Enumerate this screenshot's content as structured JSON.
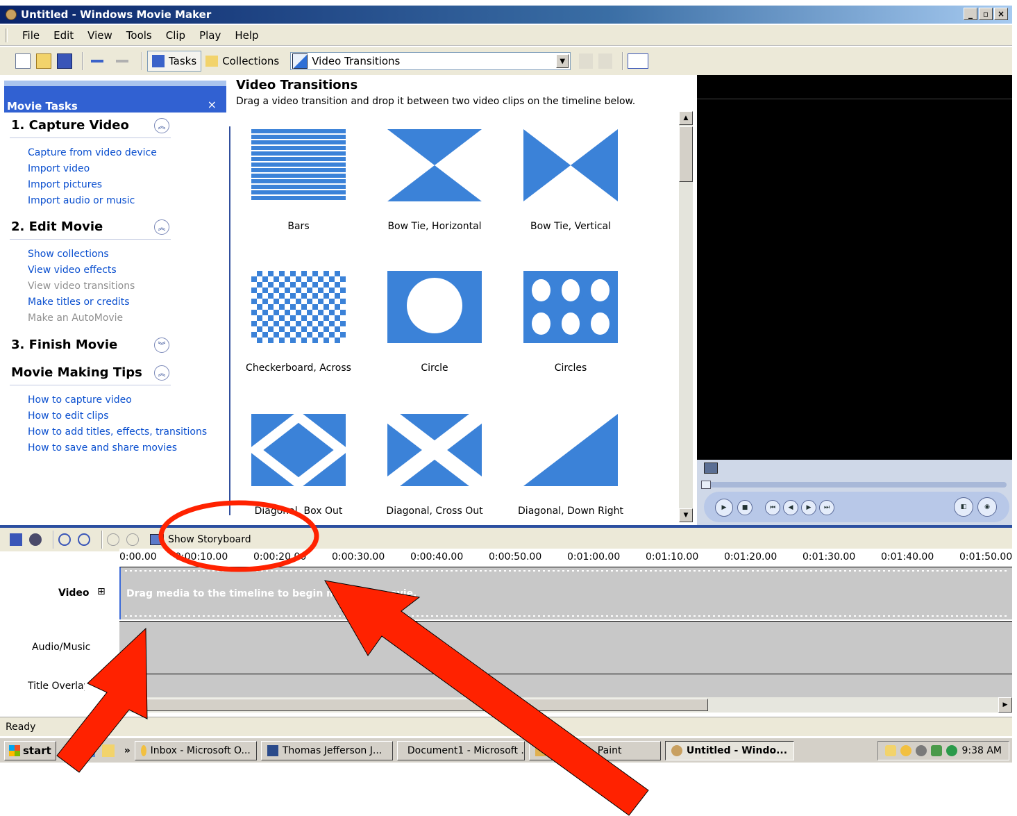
{
  "window": {
    "title": "Untitled - Windows Movie Maker",
    "min": "_",
    "max": "▫",
    "close": "×"
  },
  "menu": [
    "File",
    "Edit",
    "View",
    "Tools",
    "Clip",
    "Play",
    "Help"
  ],
  "toolbar": {
    "tasks_label": "Tasks",
    "collections_label": "Collections",
    "collection_select": "Video Transitions"
  },
  "task_pane": {
    "header": "Movie Tasks",
    "close": "×",
    "sections": [
      {
        "title": "1. Capture Video",
        "chevron": "up",
        "links": [
          {
            "text": "Capture from video device",
            "enabled": true
          },
          {
            "text": "Import video",
            "enabled": true
          },
          {
            "text": "Import pictures",
            "enabled": true
          },
          {
            "text": "Import audio or music",
            "enabled": true
          }
        ]
      },
      {
        "title": "2. Edit Movie",
        "chevron": "up",
        "links": [
          {
            "text": "Show collections",
            "enabled": true
          },
          {
            "text": "View video effects",
            "enabled": true
          },
          {
            "text": "View video transitions",
            "enabled": false
          },
          {
            "text": "Make titles or credits",
            "enabled": true
          },
          {
            "text": "Make an AutoMovie",
            "enabled": false
          }
        ]
      },
      {
        "title": "3. Finish Movie",
        "chevron": "down",
        "links": []
      },
      {
        "title": "Movie Making Tips",
        "chevron": "up",
        "links": [
          {
            "text": "How to capture video",
            "enabled": true
          },
          {
            "text": "How to edit clips",
            "enabled": true
          },
          {
            "text": "How to add titles, effects, transitions",
            "enabled": true
          },
          {
            "text": "How to save and share movies",
            "enabled": true
          }
        ]
      }
    ]
  },
  "collection": {
    "title": "Video Transitions",
    "description": "Drag a video transition and drop it between two video clips on the timeline below.",
    "items": [
      "Bars",
      "Bow Tie, Horizontal",
      "Bow Tie, Vertical",
      "Checkerboard, Across",
      "Circle",
      "Circles",
      "Diagonal, Box Out",
      "Diagonal, Cross Out",
      "Diagonal, Down Right"
    ]
  },
  "timeline": {
    "show_storyboard": "Show Storyboard",
    "ruler": [
      "0:00.00",
      "0:00:10.00",
      "0:00:20.00",
      "0:00:30.00",
      "0:00:40.00",
      "0:00:50.00",
      "0:01:00.00",
      "0:01:10.00",
      "0:01:20.00",
      "0:01:30.00",
      "0:01:40.00",
      "0:01:50.00"
    ],
    "tracks": {
      "video": "Video",
      "audio": "Audio/Music",
      "title": "Title Overlay"
    },
    "expand": "⊞",
    "drag_hint": "Drag media to the timeline to begin making a movie."
  },
  "status": "Ready",
  "taskbar": {
    "start": "start",
    "chevron": "»",
    "buttons": [
      {
        "label": "Inbox - Microsoft O...",
        "icon": "outlook-icon",
        "active": false
      },
      {
        "label": "Thomas Jefferson J...",
        "icon": "website-icon",
        "active": false
      },
      {
        "label": "Document1 - Microsoft ...",
        "icon": "word-icon",
        "active": false
      },
      {
        "label": "untitled - Paint",
        "icon": "paint-icon",
        "active": false
      },
      {
        "label": "Untitled - Windo...",
        "icon": "movie-maker-icon",
        "active": true
      }
    ],
    "clock": "9:38 AM"
  },
  "colors": {
    "annotation": "#ff2200",
    "link": "#0a4fcf",
    "transition_blue": "#3b82d8"
  }
}
